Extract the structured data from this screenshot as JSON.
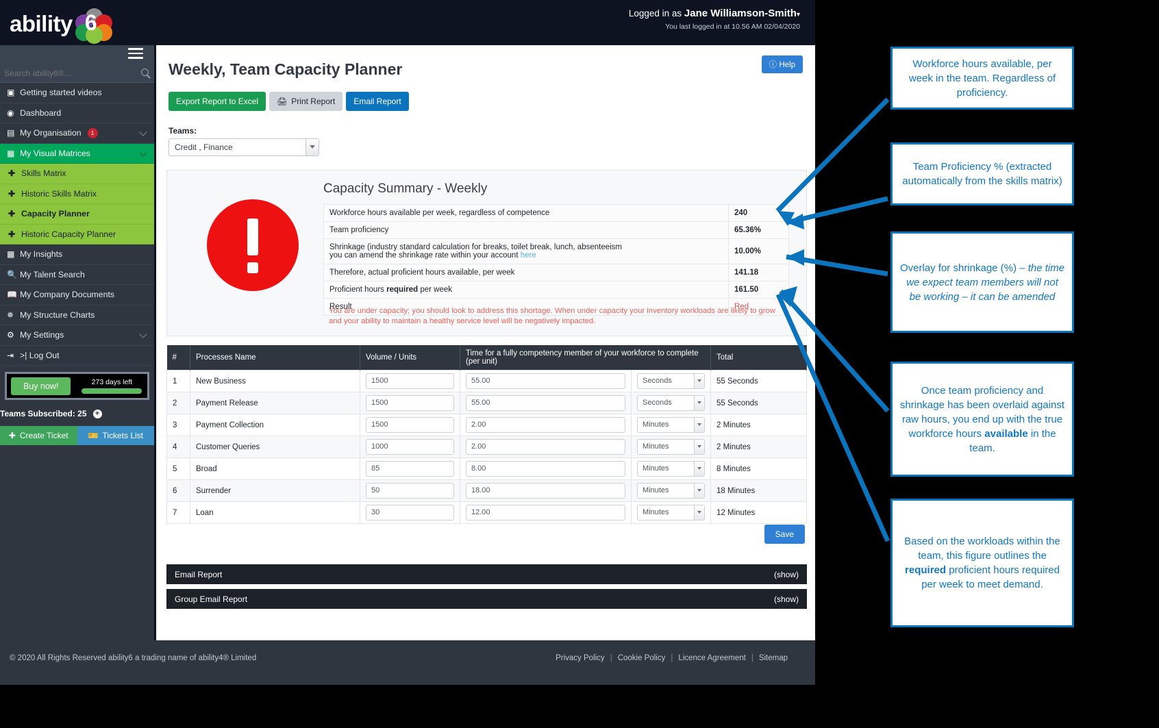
{
  "header": {
    "logo_text": "ability",
    "logo_six": "6",
    "logged_in_as_label": "Logged in as",
    "user_name": "Jane Williamson-Smith",
    "last_login": "You last logged in at 10.56 AM 02/04/2020"
  },
  "sidebar": {
    "search_placeholder": "Search ability6®....",
    "items": [
      {
        "label": "Getting started videos",
        "icon": "video-icon"
      },
      {
        "label": "Dashboard",
        "icon": "dashboard-icon"
      },
      {
        "label": "My Organisation",
        "icon": "organisation-icon",
        "badge": "1",
        "caret": true
      },
      {
        "label": "My Visual Matrices",
        "icon": "grid-icon",
        "caret": true,
        "active": true
      },
      {
        "label": "Skills Matrix",
        "icon": "plus-icon",
        "sub": true
      },
      {
        "label": "Historic Skills Matrix",
        "icon": "plus-icon",
        "sub": true
      },
      {
        "label": "Capacity Planner",
        "icon": "plus-icon",
        "sub": true,
        "bold": true
      },
      {
        "label": "Historic Capacity Planner",
        "icon": "plus-icon",
        "sub": true
      },
      {
        "label": "My Insights",
        "icon": "grid-icon"
      },
      {
        "label": "My Talent Search",
        "icon": "search-icon"
      },
      {
        "label": "My Company Documents",
        "icon": "documents-icon"
      },
      {
        "label": "My Structure Charts",
        "icon": "structure-chart-icon"
      },
      {
        "label": "My Settings",
        "icon": "gear-icon",
        "caret": true
      },
      {
        "label": ">| Log Out",
        "icon": "logout-icon"
      }
    ],
    "buy_now_label": "Buy now!",
    "days_left": "273 days left",
    "teams_subscribed": "Teams Subscribed: 25",
    "create_ticket_label": "Create Ticket",
    "tickets_list_label": "Tickets List"
  },
  "main": {
    "page_title": "Weekly, Team Capacity Planner",
    "help_label": "Help",
    "buttons": {
      "export_excel": "Export Report to Excel",
      "print_report": "Print Report",
      "email_report": "Email Report"
    },
    "teams_label": "Teams:",
    "team_selected": "Credit , Finance",
    "summary": {
      "title": "Capacity Summary - Weekly",
      "rows": [
        {
          "label": "Workforce hours available per week, regardless of competence",
          "value": "240"
        },
        {
          "label": "Team proficiency",
          "value": "65.36%"
        },
        {
          "label": "Shrinkage (industry standard calculation for breaks, toilet break, lunch, absenteeism",
          "label2": "you can amend the shrinkage rate within your account ",
          "link": "here",
          "value": "10.00%"
        },
        {
          "label": "Therefore, actual proficient hours available, per week",
          "value": "141.18"
        },
        {
          "label": "Proficient hours required per week",
          "label_bold_part": "required",
          "value": "161.50"
        },
        {
          "label": "Result",
          "value": "Red",
          "value_red": true
        }
      ],
      "warning": "You are under capacity; you should look to address this shortage. When under capacity your inventory workloads are likely to grow and your ability to maintain a healthy service level will be negatively impacted."
    },
    "process_table": {
      "headers": [
        "#",
        "Processes Name",
        "Volume / Units",
        "Time for a fully competency member of your workforce to complete (per unit)",
        "",
        "Total"
      ],
      "rows": [
        {
          "num": "1",
          "name": "New Business",
          "volume": "1500",
          "time": "55.00",
          "unit": "Seconds",
          "total": "55 Seconds"
        },
        {
          "num": "2",
          "name": "Payment Release",
          "volume": "1500",
          "time": "55.00",
          "unit": "Seconds",
          "total": "55 Seconds"
        },
        {
          "num": "3",
          "name": "Payment Collection",
          "volume": "1500",
          "time": "2.00",
          "unit": "Minutes",
          "total": "2 Minutes"
        },
        {
          "num": "4",
          "name": "Customer Queries",
          "volume": "1000",
          "time": "2.00",
          "unit": "Minutes",
          "total": "2 Minutes"
        },
        {
          "num": "5",
          "name": "Broad",
          "volume": "85",
          "time": "8.00",
          "unit": "Minutes",
          "total": "8 Minutes"
        },
        {
          "num": "6",
          "name": "Surrender",
          "volume": "50",
          "time": "18.00",
          "unit": "Minutes",
          "total": "18 Minutes"
        },
        {
          "num": "7",
          "name": "Loan",
          "volume": "30",
          "time": "12.00",
          "unit": "Minutes",
          "total": "12 Minutes"
        }
      ]
    },
    "save_label": "Save",
    "email_report_bar": {
      "label": "Email Report",
      "toggle": "(show)"
    },
    "group_email_report_bar": {
      "label": "Group Email Report",
      "toggle": "(show)"
    }
  },
  "footer": {
    "copyright": "© 2020 All Rights Reserved ability6 a trading name of ability4® Limited",
    "links": [
      "Privacy Policy",
      "Cookie Policy",
      "Licence Agreement",
      "Sitemap"
    ]
  },
  "annotations": [
    {
      "id": "callout-workforce-hours",
      "text": "Workforce hours available, per week in the team. Regardless of proficiency."
    },
    {
      "id": "callout-team-proficiency",
      "text": "Team Proficiency % (extracted automatically from the skills matrix)"
    },
    {
      "id": "callout-shrinkage",
      "text_plain": "Overlay for shrinkage (%) – ",
      "text_italic": "the time we expect team members will not be working – it can be amended"
    },
    {
      "id": "callout-available-hours",
      "pre": "Once team proficiency and shrinkage has been overlaid against raw hours, you end up with the true workforce hours ",
      "bold": "available",
      "post": " in the team."
    },
    {
      "id": "callout-required-hours",
      "pre": "Based on the workloads within the team, this figure outlines the ",
      "bold": "required",
      "post": " proficient hours required per week to meet demand."
    }
  ],
  "colors": {
    "brand_dark": "#0d1321",
    "sidebar": "#2f3640",
    "accent_green": "#00a65a",
    "sub_green": "#8cc63e",
    "blue": "#0b74bd",
    "red": "#ee1111",
    "callout_blue": "#1277c4"
  }
}
